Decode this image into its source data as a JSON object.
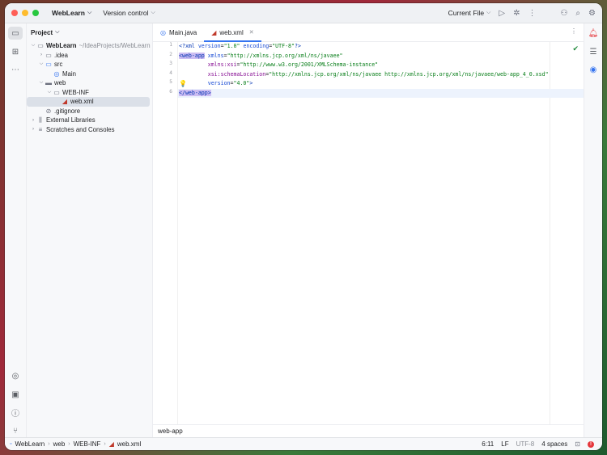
{
  "titlebar": {
    "project": "WebLearn",
    "vcs": "Version control",
    "run_config": "Current File"
  },
  "project_panel": {
    "title": "Project",
    "tree": [
      {
        "label": "WebLearn",
        "suffix": "~/IdeaProjects/WebLearn"
      },
      {
        "label": ".idea"
      },
      {
        "label": "src"
      },
      {
        "label": "Main"
      },
      {
        "label": "web"
      },
      {
        "label": "WEB-INF"
      },
      {
        "label": "web.xml"
      },
      {
        "label": ".gitignore"
      },
      {
        "label": "External Libraries"
      },
      {
        "label": "Scratches and Consoles"
      }
    ]
  },
  "editor": {
    "tabs": [
      {
        "label": "Main.java"
      },
      {
        "label": "web.xml"
      }
    ],
    "line_numbers": [
      "1",
      "2",
      "3",
      "4",
      "5",
      "6"
    ],
    "code": {
      "l1": {
        "a": "<?xml ",
        "b": "version",
        "c": "=",
        "d": "\"1.0\"",
        "e": " ",
        "f": "encoding",
        "g": "=",
        "h": "\"UTF-8\"",
        "i": "?>"
      },
      "l2": {
        "a": "<web-app",
        "b": " ",
        "c": "xmlns",
        "d": "=",
        "e": "\"http://xmlns.jcp.org/xml/ns/javaee\""
      },
      "l3": {
        "a": "         ",
        "b": "xmlns:xsi",
        "c": "=",
        "d": "\"http://www.w3.org/2001/XMLSchema-instance\""
      },
      "l4": {
        "a": "         ",
        "b": "xsi:schemaLocation",
        "c": "=",
        "d": "\"http://xmlns.jcp.org/xml/ns/javaee http://xmlns.jcp.org/xml/ns/javaee/web-app_4_0.xsd\""
      },
      "l5": {
        "a": "         ",
        "b": "version",
        "c": "=",
        "d": "\"4.0\"",
        "e": ">"
      },
      "l6": {
        "a": "</web-app>"
      }
    },
    "breadcrumb": "web-app"
  },
  "statusbar": {
    "crumbs": [
      "WebLearn",
      "web",
      "WEB-INF",
      "web.xml"
    ],
    "position": "6:11",
    "line_sep": "LF",
    "encoding": "UTF-8",
    "indent": "4 spaces"
  },
  "colors": {
    "accent": "#3574f0",
    "error": "#e5373c",
    "ok": "#208a3c"
  }
}
